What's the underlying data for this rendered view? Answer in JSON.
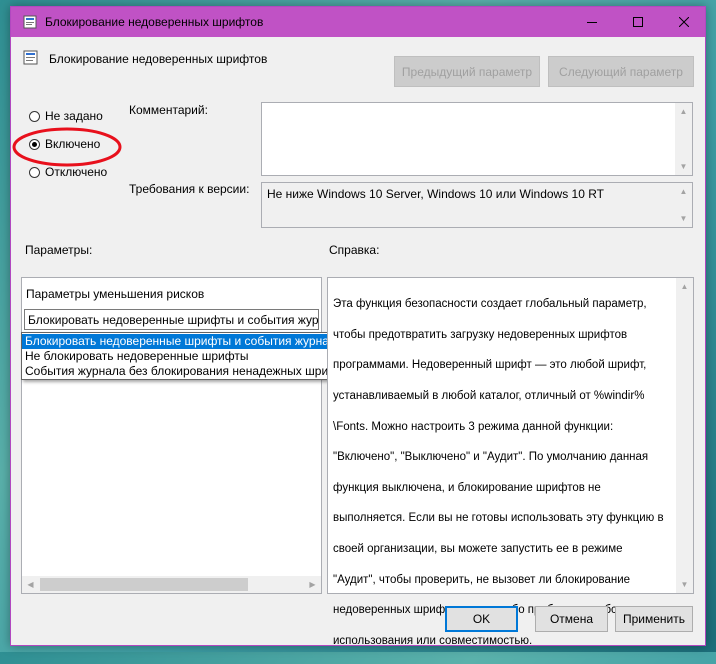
{
  "window": {
    "title": "Блокирование недоверенных шрифтов"
  },
  "header": {
    "policy_name": "Блокирование недоверенных шрифтов",
    "prev_button": "Предыдущий параметр",
    "next_button": "Следующий параметр"
  },
  "state": {
    "options": [
      "Не задано",
      "Включено",
      "Отключено"
    ],
    "selected": "Включено"
  },
  "comment": {
    "label": "Комментарий:",
    "value": ""
  },
  "requirements": {
    "label": "Требования к версии:",
    "value": "Не ниже Windows 10 Server, Windows 10 или Windows 10 RT"
  },
  "params": {
    "label": "Параметры:",
    "section_title": "Параметры уменьшения рисков",
    "combo_value": "Блокировать недоверенные шрифты и события журнала.",
    "options": [
      "Блокировать недоверенные шрифты и события журнала.",
      "Не блокировать недоверенные шрифты",
      "События журнала без блокирования ненадежных шрифтов"
    ]
  },
  "help": {
    "label": "Справка:",
    "text": "Эта функция безопасности создает глобальный параметр, чтобы предотвратить загрузку недоверенных шрифтов программами. Недоверенный шрифт — это любой шрифт, устанавливаемый в любой каталог, отличный от %windir% \\Fonts. Можно настроить 3 режима данной функции: \"Включено\", \"Выключено\" и \"Аудит\". По умолчанию данная функция выключена, и блокирование шрифтов не выполняется. Если вы не готовы использовать эту функцию в своей организации, вы можете запустить ее в режиме \"Аудит\", чтобы проверить, не вызовет ли блокирование недоверенных шрифтов каких-либо проблем с удобством использования или совместимостью.",
    "lines": [
      "Эта функция безопасности создает глобальный параметр,",
      "чтобы предотвратить загрузку недоверенных шрифтов",
      "программами. Недоверенный шрифт — это любой шрифт,",
      "устанавливаемый в любой каталог, отличный от %windir%",
      "\\Fonts. Можно настроить 3 режима данной функции:",
      "\"Включено\", \"Выключено\" и \"Аудит\". По умолчанию данная",
      "функция выключена, и блокирование шрифтов не",
      "выполняется. Если вы не готовы использовать эту функцию в",
      "своей организации, вы можете запустить ее в режиме",
      "\"Аудит\", чтобы проверить, не вызовет ли блокирование",
      "недоверенных шрифтов каких-либо проблем с удобством",
      "использования или совместимостью."
    ]
  },
  "footer": {
    "ok": "OK",
    "cancel": "Отмена",
    "apply": "Применить"
  },
  "annotation": {
    "color": "#e8101c",
    "target": "Включено"
  },
  "colors": {
    "titlebar": "#c052c5",
    "selection": "#0078d7"
  },
  "icons": {
    "app": "policy-icon",
    "minimize": "minimize-icon",
    "maximize": "maximize-icon",
    "close": "close-icon"
  }
}
